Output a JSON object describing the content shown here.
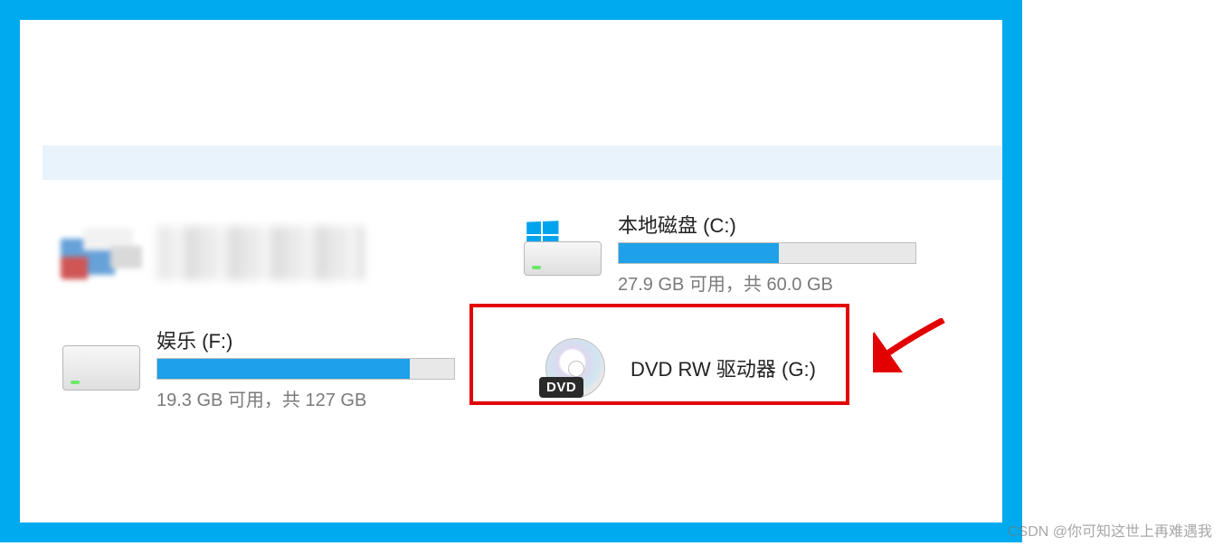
{
  "drives": {
    "c": {
      "name": "本地磁盘 (C:)",
      "stats": "27.9 GB 可用，共 60.0 GB",
      "fill_percent": 54
    },
    "f": {
      "name": "娱乐 (F:)",
      "stats": "19.3 GB 可用，共 127 GB",
      "fill_percent": 85
    },
    "g": {
      "name": "DVD RW 驱动器 (G:)"
    }
  },
  "dvd_badge": "DVD",
  "watermark": "CSDN @你可知这世上再难遇我"
}
